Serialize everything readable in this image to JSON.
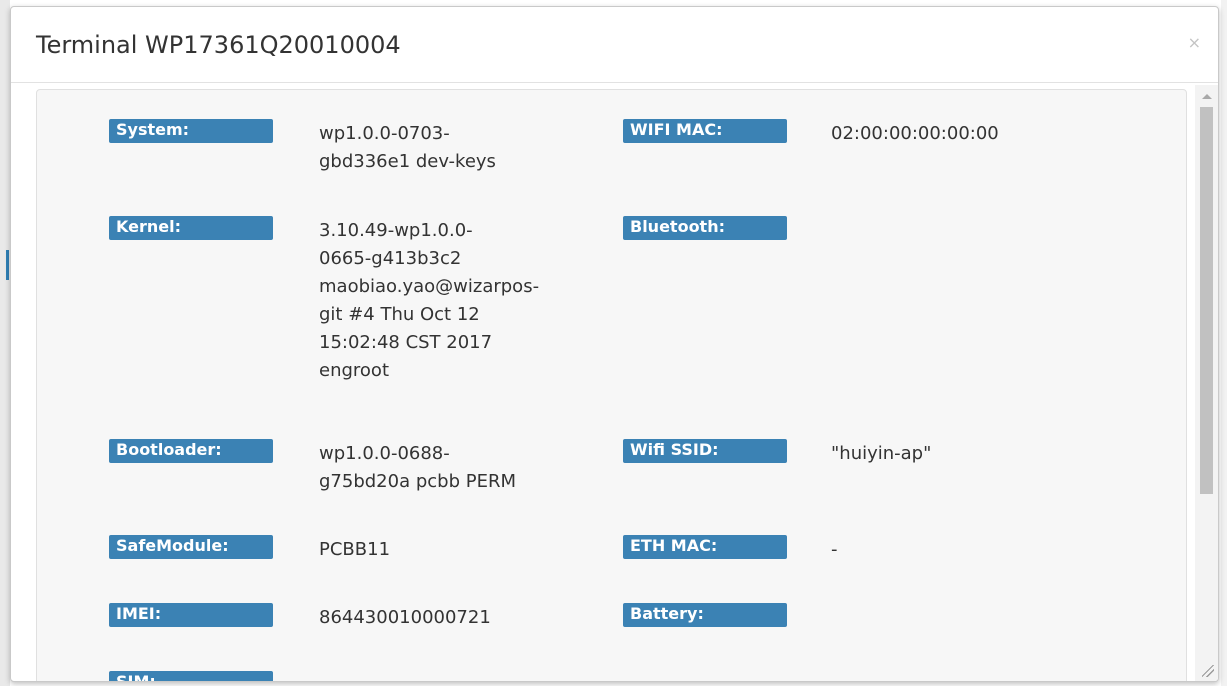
{
  "modal": {
    "title": "Terminal WP17361Q20010004",
    "close_glyph": "×"
  },
  "left_fields": [
    {
      "label": "System:",
      "value": "wp1.0.0-0703-\ngbd336e1 dev-keys"
    },
    {
      "label": "Kernel:",
      "value": "3.10.49-wp1.0.0-\n0665-g413b3c2\nmaobiao.yao@wizarpos-\ngit #4 Thu Oct 12\n15:02:48 CST 2017\nengroot"
    },
    {
      "label": "Bootloader:",
      "value": "wp1.0.0-0688-\ng75bd20a pcbb PERM"
    },
    {
      "label": "SafeModule:",
      "value": "PCBB11"
    },
    {
      "label": "IMEI:",
      "value": "864430010000721"
    },
    {
      "label": "SIM:",
      "value": ""
    }
  ],
  "right_fields": [
    {
      "label": "WIFI MAC:",
      "value": "02:00:00:00:00:00"
    },
    {
      "label": "Bluetooth:",
      "value": ""
    },
    {
      "label": "Wifi SSID:",
      "value": "\"huiyin-ap\""
    },
    {
      "label": "ETH MAC:",
      "value": "-"
    },
    {
      "label": "Battery:",
      "value": ""
    }
  ],
  "colors": {
    "label_bg": "#3b82b4",
    "body_bg": "#f7f7f7"
  }
}
